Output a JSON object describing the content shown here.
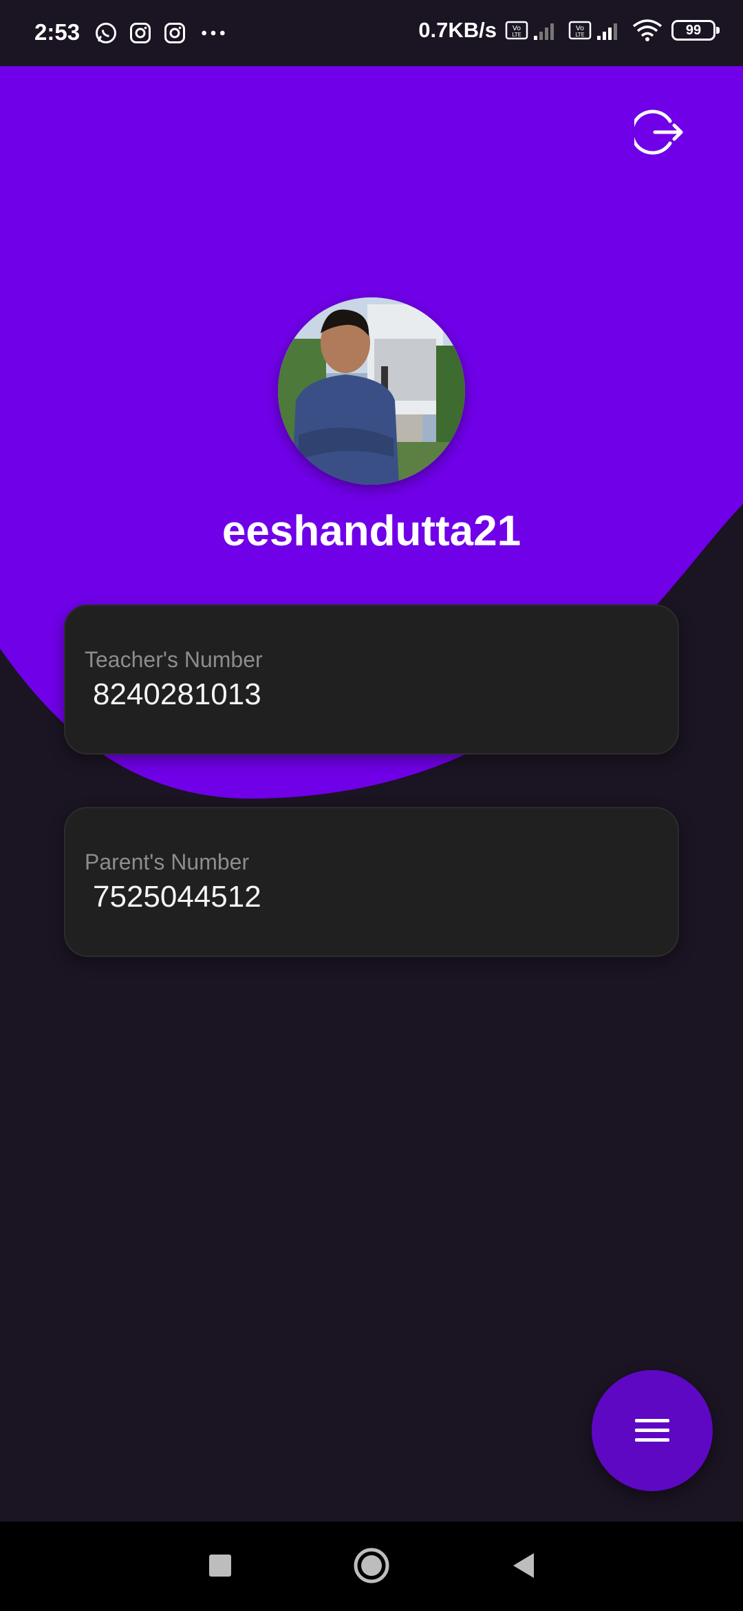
{
  "status_bar": {
    "time": "2:53",
    "net_speed": "0.7KB/s",
    "battery": "99",
    "notification_icons": [
      "whatsapp-icon",
      "instagram-icon",
      "instagram-icon",
      "more-dots-icon"
    ]
  },
  "profile": {
    "username": "eeshandutta21"
  },
  "cards": [
    {
      "label": "Teacher's Number",
      "value": "8240281013"
    },
    {
      "label": "Parent's Number",
      "value": "7525044512"
    }
  ],
  "actions": {
    "logout_icon": "logout-icon",
    "menu_icon": "menu-icon"
  },
  "colors": {
    "accent": "#7000e8",
    "background": "#1b1423",
    "card": "#202020",
    "fab": "#5e08c4"
  }
}
